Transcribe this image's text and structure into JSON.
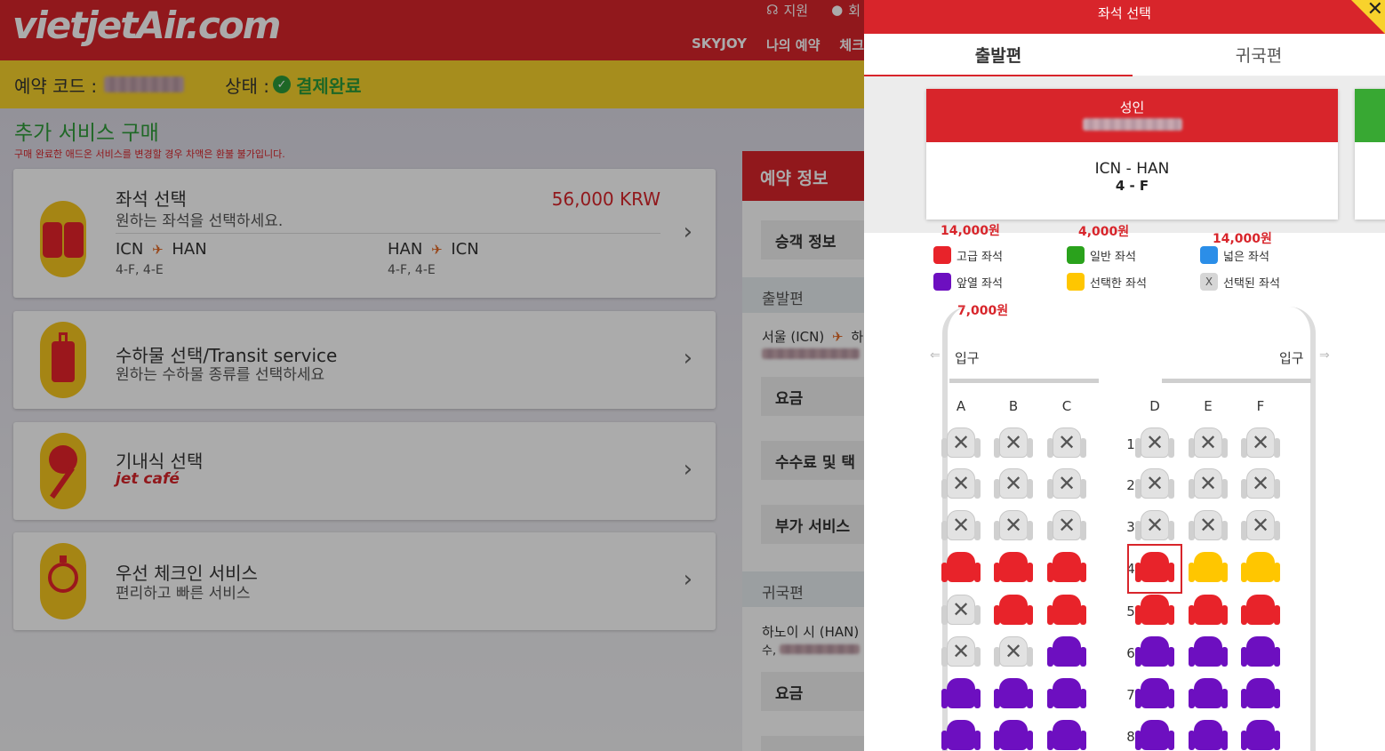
{
  "header": {
    "logo": "vietjetAir.com",
    "top_links": [
      "지원",
      "회"
    ],
    "menu": [
      "SKYJOY",
      "나의 예약",
      "체크"
    ]
  },
  "status": {
    "booking_code_label": "예약 코드 :",
    "state_label": "상태 :",
    "state_value": "결제완료"
  },
  "extra_services": {
    "title": "추가 서비스 구매",
    "note": "구매 완료한 애드온 서비스를 변경할 경우 차액은 환불 불가입니다.",
    "cards": [
      {
        "title": "좌석 선택",
        "subtitle": "원하는 좌석을 선택하세요.",
        "price": "56,000 KRW",
        "routes": [
          {
            "from": "ICN",
            "to": "HAN",
            "seats": "4-F, 4-E"
          },
          {
            "from": "HAN",
            "to": "ICN",
            "seats": "4-F, 4-E"
          }
        ]
      },
      {
        "title": "수하물 선택/Transit service",
        "subtitle": "원하는 수하물 종류를 선택하세요"
      },
      {
        "title": "기내식 선택",
        "subtitle": "jet café"
      },
      {
        "title": "우선 체크인 서비스",
        "subtitle": "편리하고 빠른 서비스"
      }
    ]
  },
  "booking_info": {
    "title": "예약 정보",
    "passenger_info": "승객 정보",
    "outbound_label": "출발편",
    "outbound_route": "서울 (ICN)",
    "outbound_route_to": "하",
    "fare_label": "요금",
    "fees_label": "수수료 및 택",
    "addon_label": "부가 서비스",
    "return_label": "귀국편",
    "return_route": "하노이 시 (HAN)",
    "return_sub": "수,",
    "fare_label_2": "요금"
  },
  "seat_panel": {
    "title": "좌석 선택",
    "tabs": [
      "출발편",
      "귀국편"
    ],
    "passenger": {
      "type": "성인",
      "route": "ICN - HAN",
      "seat": "4 - F"
    },
    "legend": [
      {
        "label": "고급 좌석",
        "price": "14,000원",
        "color": "#e8232a"
      },
      {
        "label": "일반 좌석",
        "price": "4,000원",
        "color": "#2aa21c"
      },
      {
        "label": "넓은 좌석",
        "price": "14,000원",
        "color": "#2b8ee8"
      },
      {
        "label": "앞열 좌석",
        "price": "7,000원",
        "color": "#6d0fc0"
      },
      {
        "label": "선택한 좌석",
        "price": "",
        "color": "#ffc600"
      },
      {
        "label": "선택된 좌석",
        "price": "",
        "color": "#d6d6d6"
      }
    ],
    "x_glyph": "X",
    "door_label": "입구",
    "columns": [
      "A",
      "B",
      "C",
      "D",
      "E",
      "F"
    ],
    "rows": [
      {
        "num": "1",
        "seats": [
          "taken",
          "taken",
          "taken",
          "taken",
          "taken",
          "taken"
        ]
      },
      {
        "num": "2",
        "seats": [
          "taken",
          "taken",
          "taken",
          "taken",
          "taken",
          "taken"
        ]
      },
      {
        "num": "3",
        "seats": [
          "taken",
          "taken",
          "taken",
          "taken",
          "taken",
          "taken"
        ]
      },
      {
        "num": "4",
        "seats": [
          "premium",
          "premium",
          "premium",
          "premium-highlight",
          "selected",
          "selected"
        ]
      },
      {
        "num": "5",
        "seats": [
          "taken",
          "premium",
          "premium",
          "premium",
          "premium",
          "premium"
        ]
      },
      {
        "num": "6",
        "seats": [
          "taken",
          "taken",
          "front",
          "front",
          "front",
          "front"
        ]
      },
      {
        "num": "7",
        "seats": [
          "front",
          "front",
          "front",
          "front",
          "front",
          "front"
        ]
      },
      {
        "num": "8",
        "seats": [
          "front",
          "front",
          "front",
          "front",
          "front",
          "front"
        ]
      }
    ]
  }
}
